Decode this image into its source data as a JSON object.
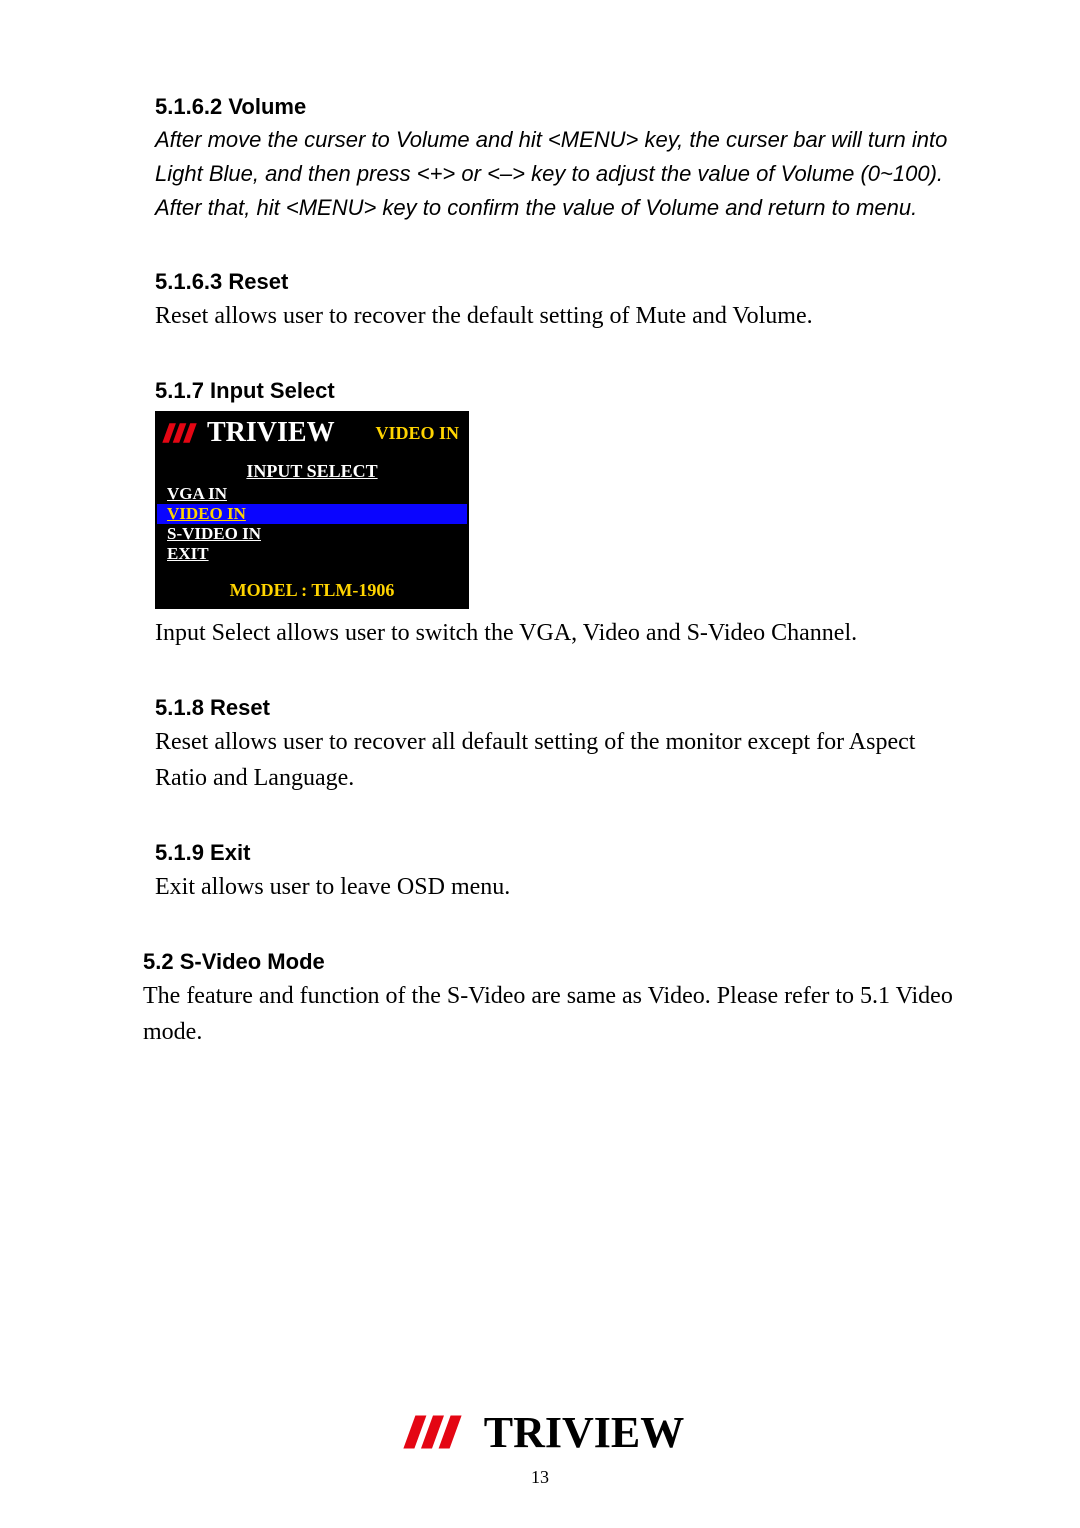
{
  "sections": {
    "s1": {
      "heading": "5.1.6.2 Volume",
      "body": "After move the curser to Volume and hit <MENU> key, the curser bar will turn into Light Blue, and then press <+> or <–> key to adjust the value of Volume (0~100). After that, hit <MENU> key to confirm the value of Volume and return to menu."
    },
    "s2": {
      "heading": "5.1.6.3 Reset",
      "body": "Reset allows user to recover the default setting of Mute and Volume."
    },
    "s3": {
      "heading": "5.1.7 Input Select",
      "body": "Input Select allows user to switch the VGA, Video and S-Video Channel."
    },
    "s4": {
      "heading": "5.1.8 Reset",
      "body": "Reset allows user to recover all default setting of the monitor except for Aspect Ratio and Language."
    },
    "s5": {
      "heading": "5.1.9 Exit",
      "body": "Exit allows user to leave OSD menu."
    },
    "s6": {
      "heading": "5.2 S-Video Mode",
      "body": "The feature and function of the S-Video are same as Video. Please refer to 5.1 Video mode."
    }
  },
  "osd": {
    "brand": "TRIVIEW",
    "source": "VIDEO IN",
    "title": "INPUT SELECT",
    "items": [
      "VGA IN",
      "VIDEO IN",
      "S-VIDEO IN",
      "EXIT"
    ],
    "selected_index": 1,
    "model": "MODEL : TLM-1906"
  },
  "footer": {
    "brand": "TRIVIEW",
    "page_number": "13"
  },
  "colors": {
    "osd_bg": "#000000",
    "osd_highlight": "#0a05ff",
    "osd_accent": "#ffd400",
    "brand_red": "#e40613"
  }
}
